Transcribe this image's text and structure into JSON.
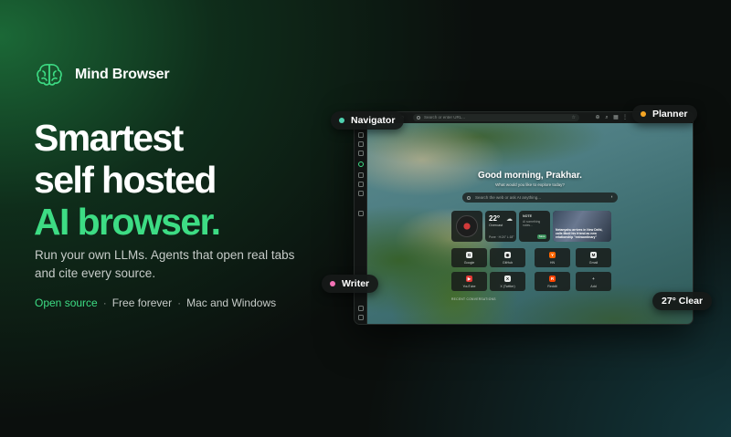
{
  "brand": {
    "name": "Mind Browser"
  },
  "hero": {
    "line1": "Smartest",
    "line2": "self hosted",
    "line3": "AI browser.",
    "description": "Run your own LLMs. Agents that open real tabs and cite every source.",
    "features": {
      "open_source": "Open source",
      "sep": "·",
      "free": "Free forever",
      "platforms": "Mac and Windows"
    }
  },
  "chips": {
    "navigator": "Navigator",
    "planner": "Planner",
    "writer": "Writer",
    "weather": "27° Clear"
  },
  "colors": {
    "accent": "#3ddc84",
    "navigator_dot": "#4fd1b0",
    "planner_dot": "#f5a524",
    "writer_dot": "#f472b6"
  },
  "browser": {
    "url_placeholder": "Search or enter URL...",
    "greeting": "Good morning, Prakhar.",
    "greeting_sub": "What would you like to explore today?",
    "search_placeholder": "Search the web or ask AI anything...",
    "weather": {
      "temp": "22°",
      "condition": "Overcast",
      "meta": "Pune  ·  H:24° L:18°"
    },
    "note": {
      "title": "NOTE",
      "body": "AI something notes...",
      "button": "Save"
    },
    "news": {
      "headline": "Netanyahu arrives in New Delhi, calls Modi his friend as new relationship \"extraordinary\""
    },
    "apps": [
      {
        "label": "Google",
        "glyph": "G"
      },
      {
        "label": "GitHub",
        "glyph": "◉"
      },
      {
        "label": "HN",
        "glyph": "Y"
      },
      {
        "label": "Gmail",
        "glyph": "M"
      },
      {
        "label": "YouTube",
        "glyph": "▶"
      },
      {
        "label": "X (Twitter)",
        "glyph": "X"
      },
      {
        "label": "Reddit",
        "glyph": "R"
      },
      {
        "label": "Add",
        "glyph": "+"
      }
    ],
    "recent_label": "RECENT CONVERSATIONS"
  }
}
